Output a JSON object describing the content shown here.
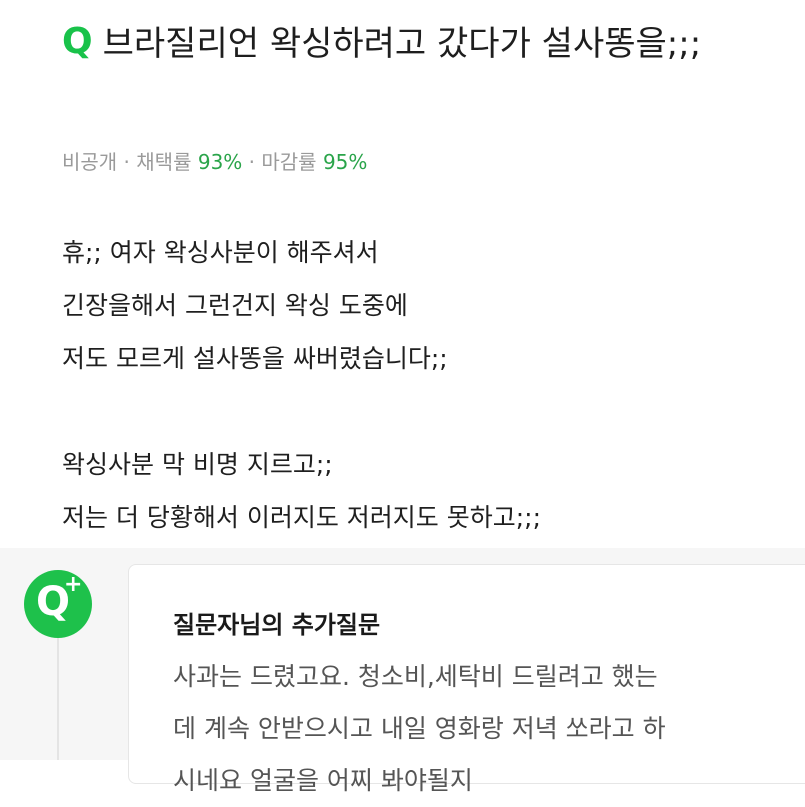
{
  "question": {
    "icon": "Q",
    "title": "브라질리언 왁싱하려고 갔다가 설사똥을;;;",
    "meta": {
      "visibility": "비공개",
      "sep": " · ",
      "adoption_label": "채택률",
      "adoption_value": "93%",
      "close_label": "마감률",
      "close_value": "95%"
    },
    "body_lines": [
      "휴;; 여자 왁싱사분이 해주셔서",
      "긴장을해서 그런건지 왁싱 도중에",
      "저도 모르게 설사똥을 싸버렸습니다;;",
      "",
      "왁싱사분 막 비명 지르고;;",
      "저는 더 당황해서 이러지도 저러지도 못하고;;;"
    ]
  },
  "additional_question": {
    "icon": "Q+",
    "heading": "질문자님의 추가질문",
    "lines": [
      "사과는 드렸고요. 청소비,세탁비 드릴려고 했는",
      "데 계속 안받으시고 내일 영화랑 저녁 쏘라고 하",
      "시네요 얼굴을 어찌 봐야될지"
    ]
  },
  "colors": {
    "accent_green": "#19c24a",
    "meta_gray": "#9a9a9a"
  }
}
